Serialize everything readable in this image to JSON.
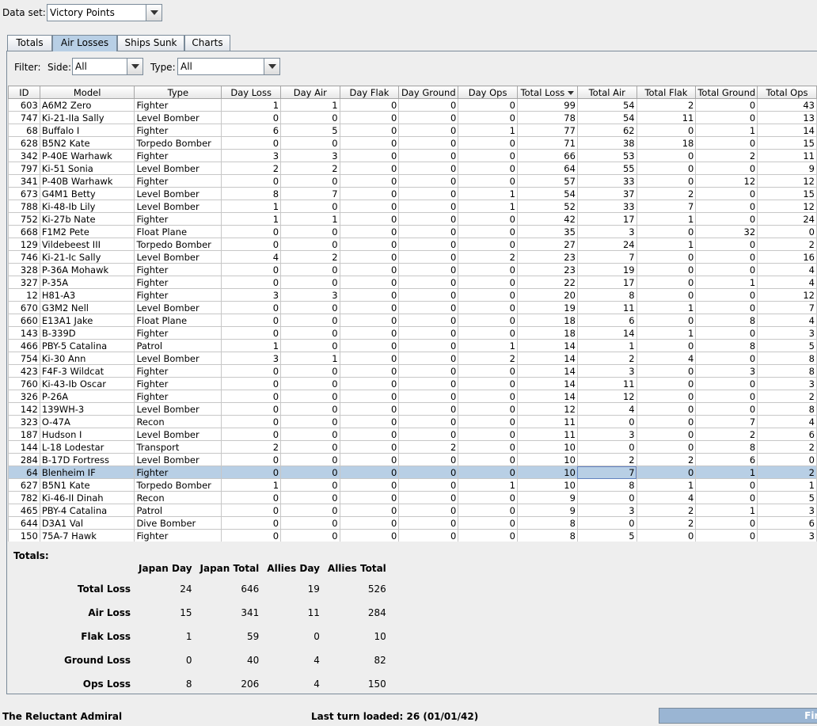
{
  "dataset": {
    "label": "Data set:",
    "value": "Victory Points"
  },
  "tabs": [
    "Totals",
    "Air Losses",
    "Ships Sunk",
    "Charts"
  ],
  "active_tab": "Air Losses",
  "filter": {
    "label": "Filter:",
    "side_label": "Side:",
    "side_value": "All",
    "type_label": "Type:",
    "type_value": "All"
  },
  "table": {
    "columns": [
      "ID",
      "Model",
      "Type",
      "Day Loss",
      "Day Air",
      "Day Flak",
      "Day Ground",
      "Day Ops",
      "Total Loss",
      "Total Air",
      "Total Flak",
      "Total Ground",
      "Total Ops"
    ],
    "sorted_column": "Total Loss",
    "selected_row_index": 29,
    "rows": [
      [
        "603",
        "A6M2 Zero",
        "Fighter",
        "1",
        "1",
        "0",
        "0",
        "0",
        "99",
        "54",
        "2",
        "0",
        "43"
      ],
      [
        "747",
        "Ki-21-IIa Sally",
        "Level Bomber",
        "0",
        "0",
        "0",
        "0",
        "0",
        "78",
        "54",
        "11",
        "0",
        "13"
      ],
      [
        "68",
        "Buffalo I",
        "Fighter",
        "6",
        "5",
        "0",
        "0",
        "1",
        "77",
        "62",
        "0",
        "1",
        "14"
      ],
      [
        "628",
        "B5N2 Kate",
        "Torpedo Bomber",
        "0",
        "0",
        "0",
        "0",
        "0",
        "71",
        "38",
        "18",
        "0",
        "15"
      ],
      [
        "342",
        "P-40E Warhawk",
        "Fighter",
        "3",
        "3",
        "0",
        "0",
        "0",
        "66",
        "53",
        "0",
        "2",
        "11"
      ],
      [
        "797",
        "Ki-51 Sonia",
        "Level Bomber",
        "2",
        "2",
        "0",
        "0",
        "0",
        "64",
        "55",
        "0",
        "0",
        "9"
      ],
      [
        "341",
        "P-40B Warhawk",
        "Fighter",
        "0",
        "0",
        "0",
        "0",
        "0",
        "57",
        "33",
        "0",
        "12",
        "12"
      ],
      [
        "673",
        "G4M1 Betty",
        "Level Bomber",
        "8",
        "7",
        "0",
        "0",
        "1",
        "54",
        "37",
        "2",
        "0",
        "15"
      ],
      [
        "788",
        "Ki-48-Ib Lily",
        "Level Bomber",
        "1",
        "0",
        "0",
        "0",
        "1",
        "52",
        "33",
        "7",
        "0",
        "12"
      ],
      [
        "752",
        "Ki-27b Nate",
        "Fighter",
        "1",
        "1",
        "0",
        "0",
        "0",
        "42",
        "17",
        "1",
        "0",
        "24"
      ],
      [
        "668",
        "F1M2 Pete",
        "Float Plane",
        "0",
        "0",
        "0",
        "0",
        "0",
        "35",
        "3",
        "0",
        "32",
        "0"
      ],
      [
        "129",
        "Vildebeest III",
        "Torpedo Bomber",
        "0",
        "0",
        "0",
        "0",
        "0",
        "27",
        "24",
        "1",
        "0",
        "2"
      ],
      [
        "746",
        "Ki-21-Ic Sally",
        "Level Bomber",
        "4",
        "2",
        "0",
        "0",
        "2",
        "23",
        "7",
        "0",
        "0",
        "16"
      ],
      [
        "328",
        "P-36A Mohawk",
        "Fighter",
        "0",
        "0",
        "0",
        "0",
        "0",
        "23",
        "19",
        "0",
        "0",
        "4"
      ],
      [
        "327",
        "P-35A",
        "Fighter",
        "0",
        "0",
        "0",
        "0",
        "0",
        "22",
        "17",
        "0",
        "1",
        "4"
      ],
      [
        "12",
        "H81-A3",
        "Fighter",
        "3",
        "3",
        "0",
        "0",
        "0",
        "20",
        "8",
        "0",
        "0",
        "12"
      ],
      [
        "670",
        "G3M2 Nell",
        "Level Bomber",
        "0",
        "0",
        "0",
        "0",
        "0",
        "19",
        "11",
        "1",
        "0",
        "7"
      ],
      [
        "660",
        "E13A1 Jake",
        "Float Plane",
        "0",
        "0",
        "0",
        "0",
        "0",
        "18",
        "6",
        "0",
        "8",
        "4"
      ],
      [
        "143",
        "B-339D",
        "Fighter",
        "0",
        "0",
        "0",
        "0",
        "0",
        "18",
        "14",
        "1",
        "0",
        "3"
      ],
      [
        "466",
        "PBY-5 Catalina",
        "Patrol",
        "1",
        "0",
        "0",
        "0",
        "1",
        "14",
        "1",
        "0",
        "8",
        "5"
      ],
      [
        "754",
        "Ki-30 Ann",
        "Level Bomber",
        "3",
        "1",
        "0",
        "0",
        "2",
        "14",
        "2",
        "4",
        "0",
        "8"
      ],
      [
        "423",
        "F4F-3 Wildcat",
        "Fighter",
        "0",
        "0",
        "0",
        "0",
        "0",
        "14",
        "3",
        "0",
        "3",
        "8"
      ],
      [
        "760",
        "Ki-43-Ib Oscar",
        "Fighter",
        "0",
        "0",
        "0",
        "0",
        "0",
        "14",
        "11",
        "0",
        "0",
        "3"
      ],
      [
        "326",
        "P-26A",
        "Fighter",
        "0",
        "0",
        "0",
        "0",
        "0",
        "14",
        "12",
        "0",
        "0",
        "2"
      ],
      [
        "142",
        "139WH-3",
        "Level Bomber",
        "0",
        "0",
        "0",
        "0",
        "0",
        "12",
        "4",
        "0",
        "0",
        "8"
      ],
      [
        "323",
        "O-47A",
        "Recon",
        "0",
        "0",
        "0",
        "0",
        "0",
        "11",
        "0",
        "0",
        "7",
        "4"
      ],
      [
        "187",
        "Hudson I",
        "Level Bomber",
        "0",
        "0",
        "0",
        "0",
        "0",
        "11",
        "3",
        "0",
        "2",
        "6"
      ],
      [
        "144",
        "L-18 Lodestar",
        "Transport",
        "2",
        "0",
        "0",
        "2",
        "0",
        "10",
        "0",
        "0",
        "8",
        "2"
      ],
      [
        "284",
        "B-17D Fortress",
        "Level Bomber",
        "0",
        "0",
        "0",
        "0",
        "0",
        "10",
        "2",
        "2",
        "6",
        "0"
      ],
      [
        "64",
        "Blenheim IF",
        "Fighter",
        "0",
        "0",
        "0",
        "0",
        "0",
        "10",
        "7",
        "0",
        "1",
        "2"
      ],
      [
        "627",
        "B5N1 Kate",
        "Torpedo Bomber",
        "1",
        "0",
        "0",
        "0",
        "1",
        "10",
        "8",
        "1",
        "0",
        "1"
      ],
      [
        "782",
        "Ki-46-II Dinah",
        "Recon",
        "0",
        "0",
        "0",
        "0",
        "0",
        "9",
        "0",
        "4",
        "0",
        "5"
      ],
      [
        "465",
        "PBY-4 Catalina",
        "Patrol",
        "0",
        "0",
        "0",
        "0",
        "0",
        "9",
        "3",
        "2",
        "1",
        "3"
      ],
      [
        "644",
        "D3A1 Val",
        "Dive Bomber",
        "0",
        "0",
        "0",
        "0",
        "0",
        "8",
        "0",
        "2",
        "0",
        "6"
      ],
      [
        "150",
        "75A-7 Hawk",
        "Fighter",
        "0",
        "0",
        "0",
        "0",
        "0",
        "8",
        "5",
        "0",
        "0",
        "3"
      ]
    ]
  },
  "totals": {
    "label": "Totals:",
    "columns": [
      "Japan Day",
      "Japan Total",
      "Allies Day",
      "Allies Total"
    ],
    "rows": [
      {
        "label": "Total Loss",
        "values": [
          "24",
          "646",
          "19",
          "526"
        ]
      },
      {
        "label": "Air Loss",
        "values": [
          "15",
          "341",
          "11",
          "284"
        ]
      },
      {
        "label": "Flak Loss",
        "values": [
          "1",
          "59",
          "0",
          "10"
        ]
      },
      {
        "label": "Ground Loss",
        "values": [
          "0",
          "40",
          "4",
          "82"
        ]
      },
      {
        "label": "Ops Loss",
        "values": [
          "8",
          "206",
          "4",
          "150"
        ]
      }
    ]
  },
  "status": {
    "app_name": "The Reluctant Admiral",
    "last_turn": "Last turn loaded: 26 (01/01/42)",
    "progress_text": "Fin",
    "progress_fraction": 1.0
  },
  "colors": {
    "selection": "#b8cfe5",
    "focus_border": "#6382bf",
    "tab_active": "#b8cfe5"
  }
}
